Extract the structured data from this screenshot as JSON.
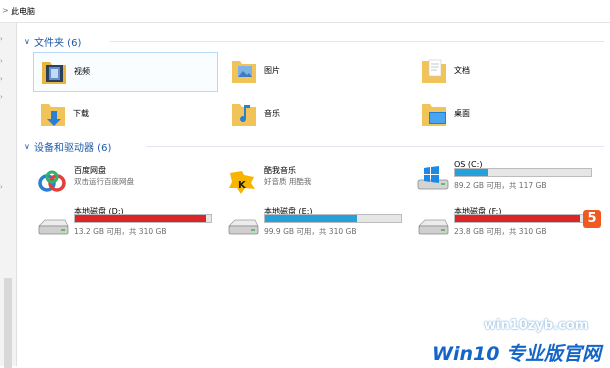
{
  "address": {
    "crumb": "此电脑"
  },
  "folders_section": {
    "title": "文件夹 (6)"
  },
  "folders": [
    {
      "label": "视频"
    },
    {
      "label": "图片"
    },
    {
      "label": "文档"
    },
    {
      "label": "下载"
    },
    {
      "label": "音乐"
    },
    {
      "label": "桌面"
    }
  ],
  "devices_section": {
    "title": "设备和驱动器 (6)"
  },
  "apps": [
    {
      "name": "百度网盘",
      "sub": "双击运行百度网盘"
    },
    {
      "name": "酷我音乐",
      "sub": "好音质 用酷我"
    }
  ],
  "drives": [
    {
      "name": "OS (C:)",
      "free": "89.2 GB 可用，共 117 GB",
      "used_fraction": 0.24,
      "color": "#26a0da"
    },
    {
      "name": "本地磁盘 (D:)",
      "free": "13.2 GB 可用，共 310 GB",
      "used_fraction": 0.96,
      "color": "#da2626"
    },
    {
      "name": "本地磁盘 (E:)",
      "free": "99.9 GB 可用，共 310 GB",
      "used_fraction": 0.68,
      "color": "#26a0da"
    },
    {
      "name": "本地磁盘 (F:)",
      "free": "23.8 GB 可用，共 310 GB",
      "used_fraction": 0.92,
      "color": "#da2626"
    }
  ],
  "watermark": {
    "url": "win10zyb.com",
    "brand": "Win10 专业版官网",
    "badge": "5"
  }
}
